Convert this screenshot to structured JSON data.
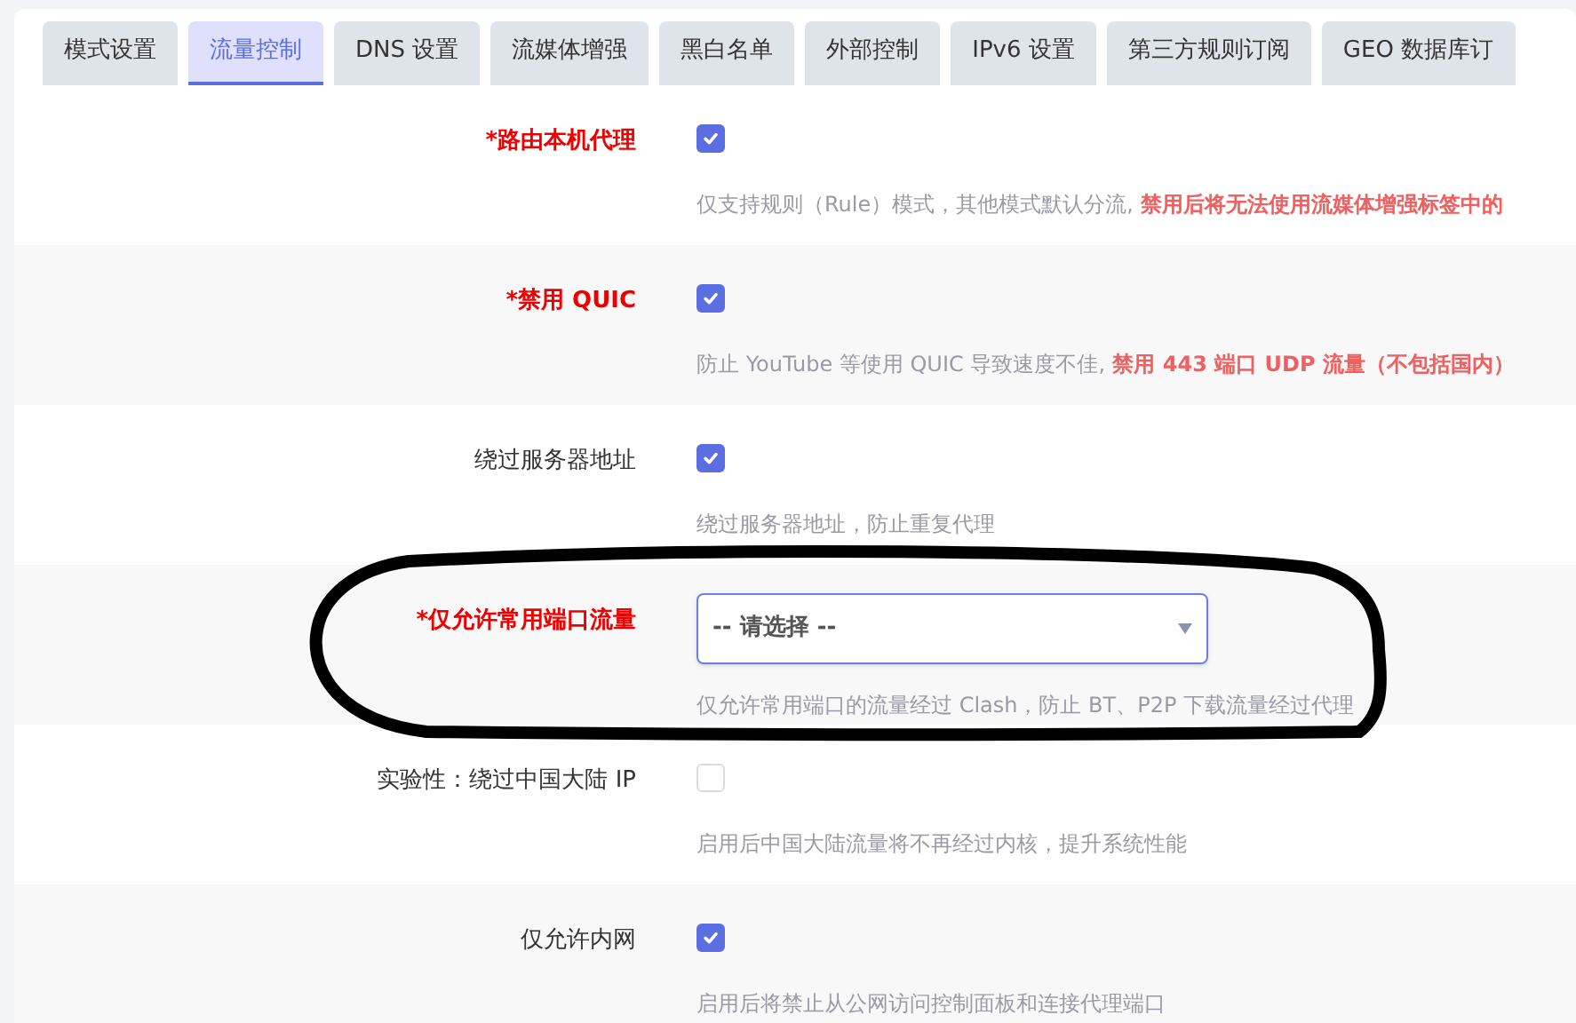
{
  "tabs": [
    {
      "label": "模式设置",
      "selected": false
    },
    {
      "label": "流量控制",
      "selected": true
    },
    {
      "label": "DNS 设置",
      "selected": false
    },
    {
      "label": "流媒体增强",
      "selected": false
    },
    {
      "label": "黑白名单",
      "selected": false
    },
    {
      "label": "外部控制",
      "selected": false
    },
    {
      "label": "IPv6 设置",
      "selected": false
    },
    {
      "label": "第三方规则订阅",
      "selected": false
    },
    {
      "label": "GEO 数据库订",
      "selected": false
    }
  ],
  "settings": [
    {
      "label": "*路由本机代理",
      "required": true,
      "kind": "checkbox",
      "checked": true,
      "note": "仅支持规则（Rule）模式，其他模式默认分流,",
      "warning": "禁用后将无法使用流媒体增强标签中的"
    },
    {
      "label": "*禁用 QUIC",
      "required": true,
      "kind": "checkbox",
      "checked": true,
      "note": "防止 YouTube 等使用 QUIC 导致速度不佳,",
      "warning": "禁用 443 端口 UDP 流量（不包括国内）"
    },
    {
      "label": "绕过服务器地址",
      "required": false,
      "kind": "checkbox",
      "checked": true,
      "note": "绕过服务器地址，防止重复代理"
    },
    {
      "label": "*仅允许常用端口流量",
      "required": true,
      "kind": "select",
      "placeholder": "-- 请选择 --",
      "note": "仅允许常用端口的流量经过 Clash，防止 BT、P2P 下载流量经过代理"
    },
    {
      "label": "实验性：绕过中国大陆 IP",
      "required": false,
      "kind": "checkbox",
      "checked": false,
      "note": "启用后中国大陆流量将不再经过内核，提升系统性能"
    },
    {
      "label": "仅允许内网",
      "required": false,
      "kind": "checkbox",
      "checked": true,
      "note": "启用后将禁止从公网访问控制面板和连接代理端口"
    }
  ]
}
